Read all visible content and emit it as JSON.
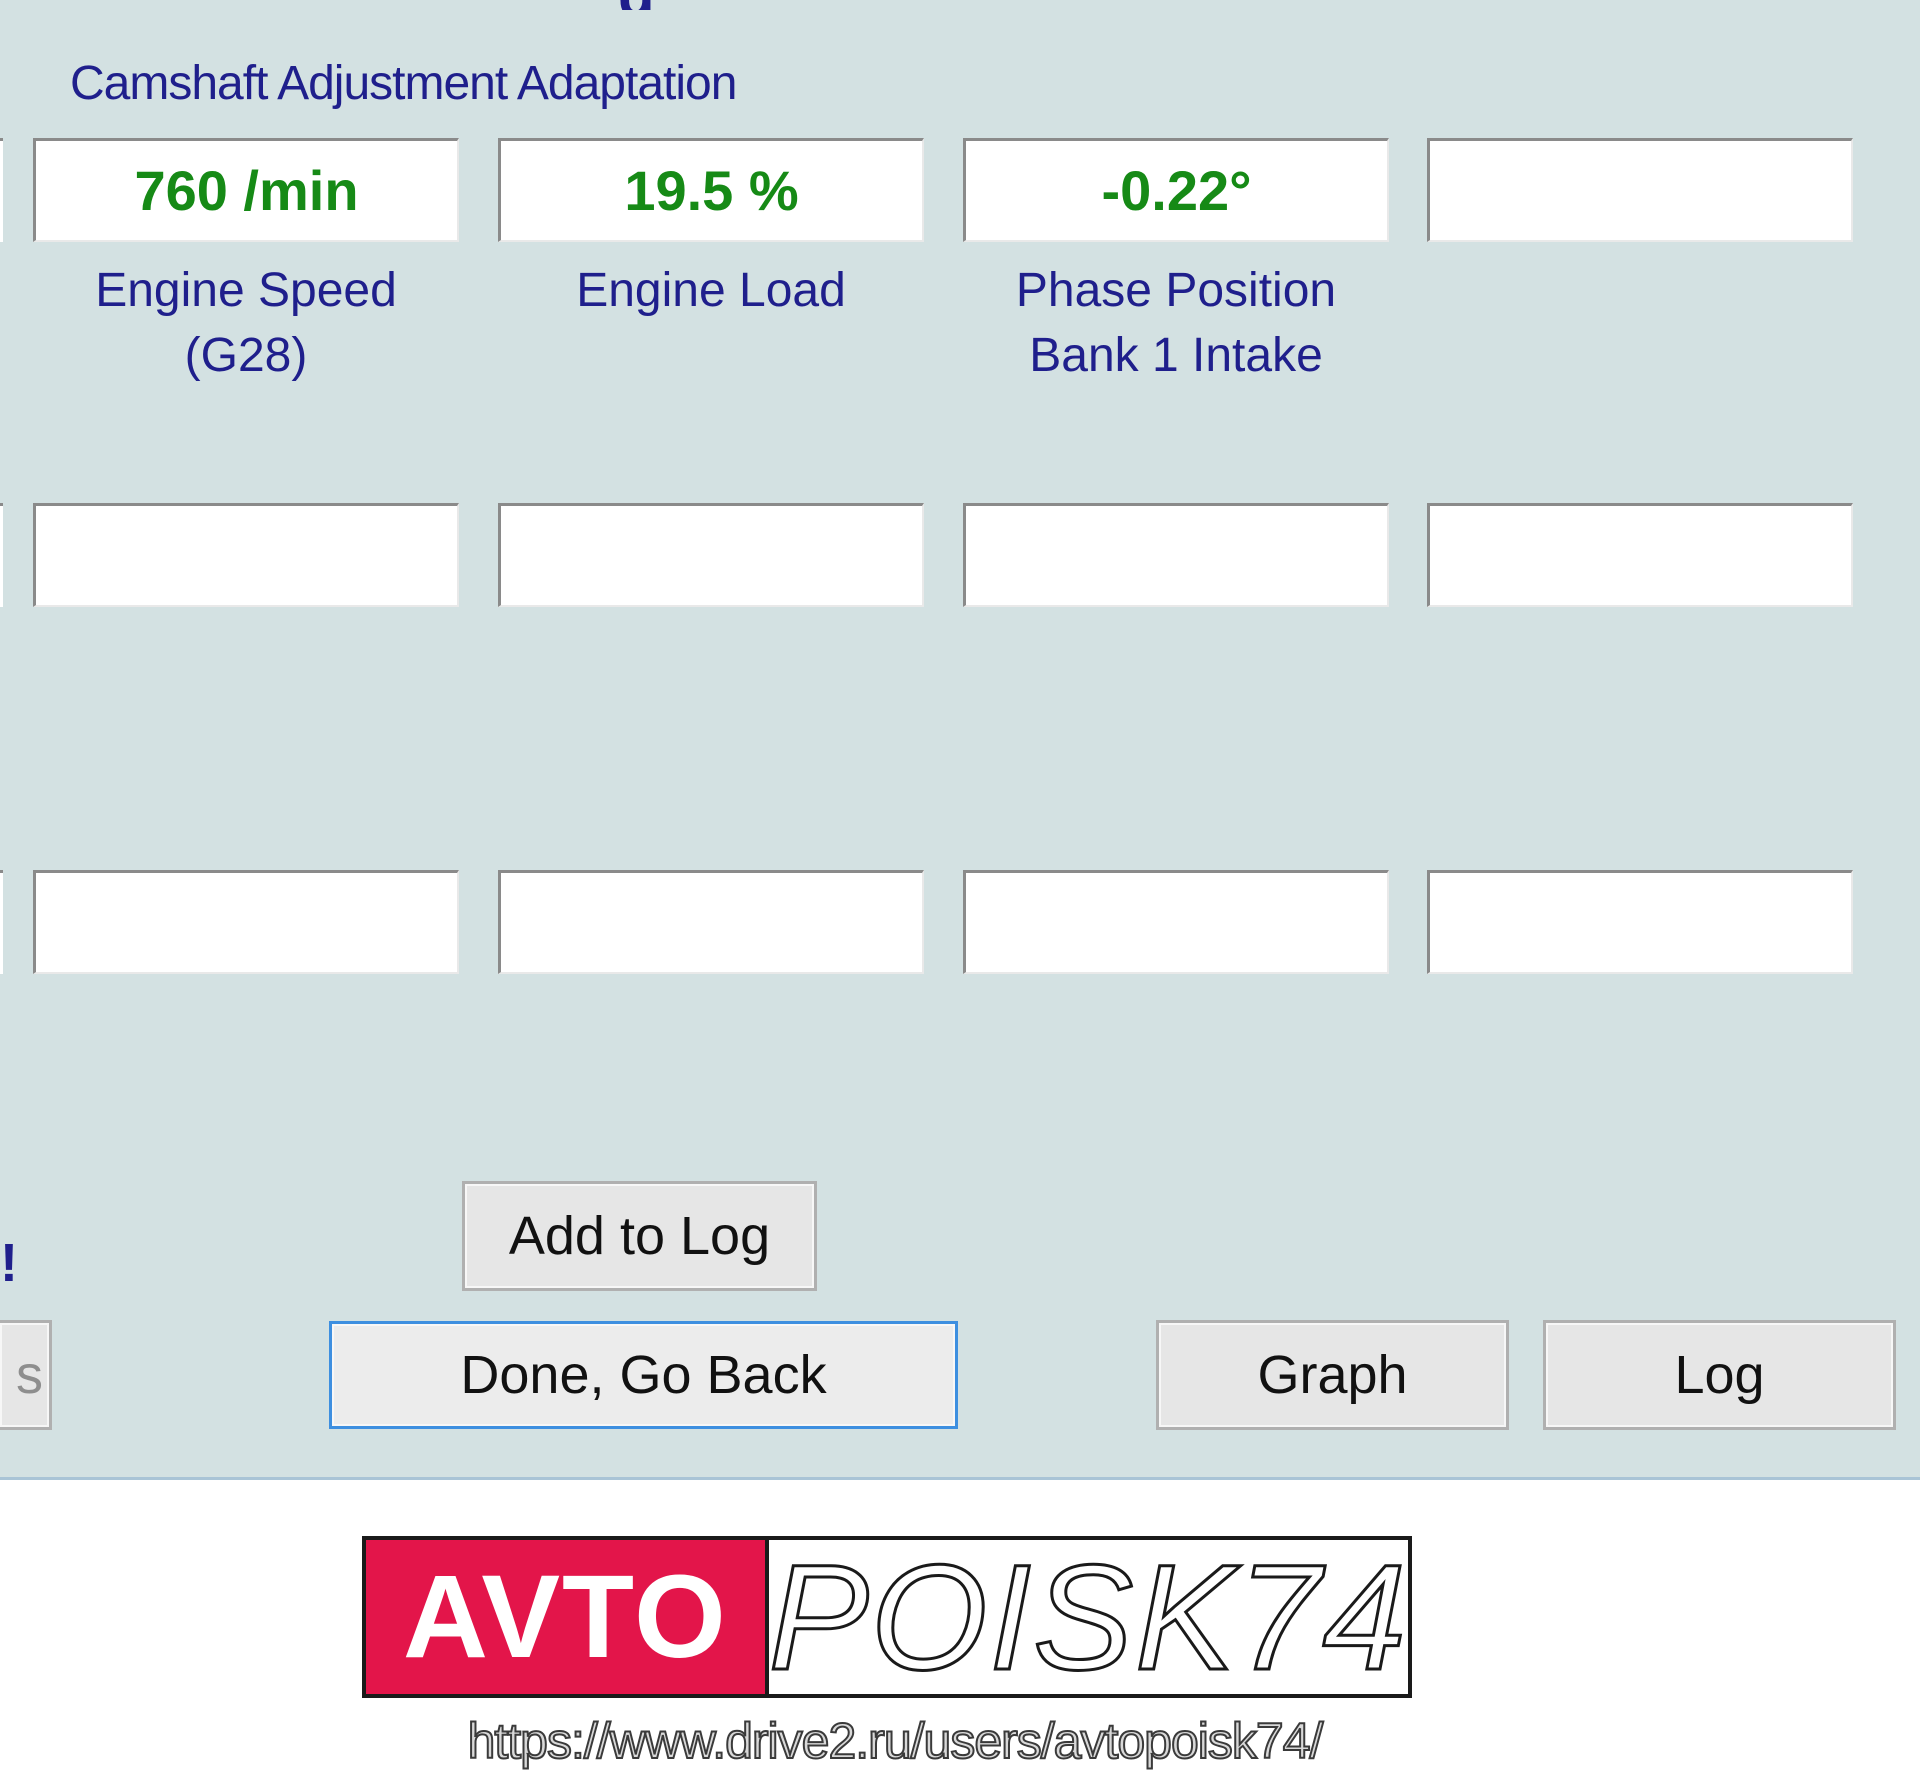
{
  "window": {
    "heading_fragment": "g"
  },
  "group": {
    "title": "Camshaft Adjustment Adaptation"
  },
  "fields": {
    "row1": [
      {
        "value": "760 /min",
        "caption_line1": "Engine Speed",
        "caption_line2": "(G28)"
      },
      {
        "value": "19.5 %",
        "caption_line1": "Engine Load",
        "caption_line2": ""
      },
      {
        "value": "-0.22°",
        "caption_line1": "Phase Position",
        "caption_line2": "Bank 1 Intake"
      },
      {
        "value": "",
        "caption_line1": "",
        "caption_line2": ""
      }
    ],
    "row2": [
      "",
      "",
      "",
      ""
    ],
    "row3": [
      "",
      "",
      "",
      ""
    ]
  },
  "left_edge": {
    "exclamation": "!",
    "partial_button_text": "s"
  },
  "buttons": {
    "add_to_log": "Add to Log",
    "done_go_back": "Done, Go Back",
    "graph": "Graph",
    "log": "Log"
  },
  "watermark": {
    "brand_left": "AVTO",
    "brand_right": "POISK74",
    "url": "https://www.drive2.ru/users/avtopoisk74/"
  },
  "colors": {
    "panel_bg": "#d3e1e2",
    "label_blue": "#1f1f8c",
    "value_green": "#168a16",
    "default_button_border": "#3d8fe0",
    "logo_red": "#e3154a"
  }
}
